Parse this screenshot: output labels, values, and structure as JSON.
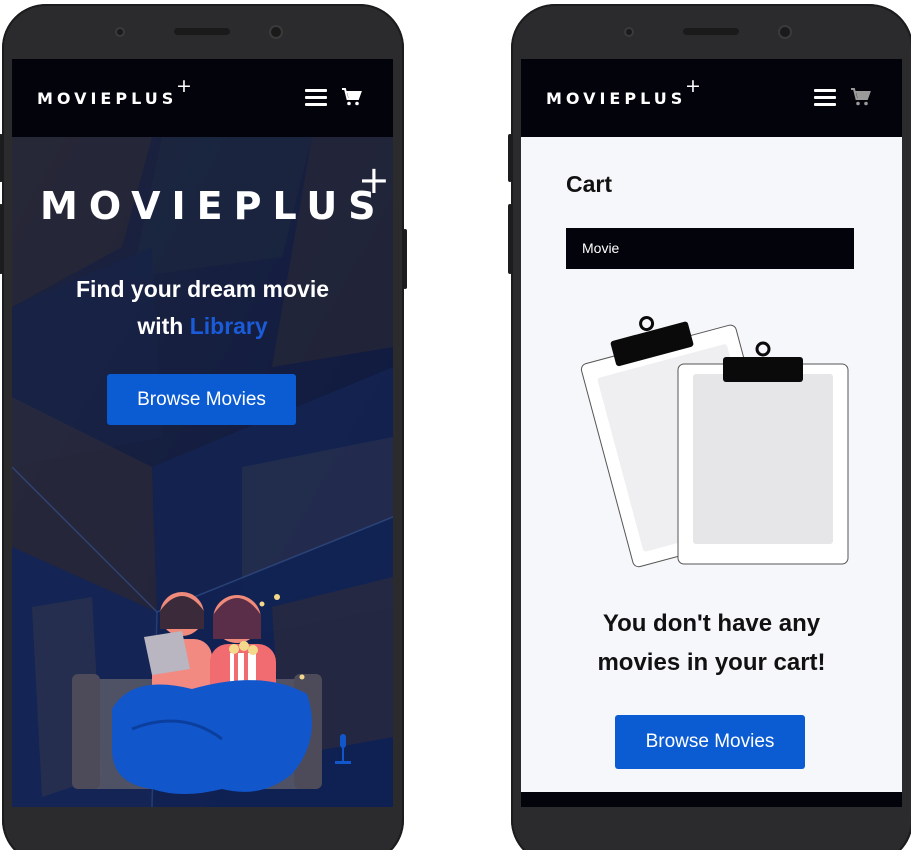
{
  "brand": {
    "name": "MOVIEPLUS",
    "plus": "+"
  },
  "left_screen": {
    "hero_title": "MOVIEPLUS",
    "hero_plus": "+",
    "headline_line1": "Find your dream movie",
    "headline_prefix": "with",
    "headline_accent": "Library",
    "browse_button": "Browse Movies"
  },
  "right_screen": {
    "page_title": "Cart",
    "table_column": "Movie",
    "empty_line1": "You don't have any",
    "empty_line2": "movies in your cart!",
    "browse_button": "Browse Movies"
  },
  "icons": {
    "menu": "hamburger-menu-icon",
    "cart": "shopping-cart-icon",
    "empty_state": "clipboard-illustration",
    "hero": "people-watching-movie-illustration"
  },
  "colors": {
    "nav_bg": "#03030c",
    "accent": "#0b5bd3",
    "accent_text": "#1a5bd8",
    "cart_bg": "#f6f7fa",
    "phone_body": "#2b2b2d"
  }
}
